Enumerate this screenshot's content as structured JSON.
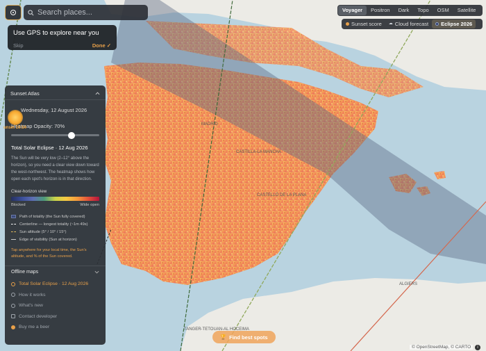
{
  "search": {
    "placeholder": "Search places..."
  },
  "gps_tip": {
    "title": "Use GPS to explore near you",
    "skip": "Skip",
    "done": "Done ✓"
  },
  "basemaps": {
    "items": [
      "Voyager",
      "Positron",
      "Dark",
      "Topo",
      "OSM",
      "Satellite"
    ],
    "active": "Voyager"
  },
  "layers": {
    "items": [
      {
        "label": "Sunset score",
        "icon": "sunset-dot-icon",
        "color": "#e8a04a"
      },
      {
        "label": "Cloud forecast",
        "icon": "cloud-icon",
        "color": "#cfd4da"
      },
      {
        "label": "Eclipse 2026",
        "icon": "eclipse-icon",
        "color": "#2d3a6a"
      }
    ],
    "active": "Eclipse 2026"
  },
  "panel": {
    "title": "Sunset Atlas",
    "date": "Wednesday, 12 August 2026",
    "opacity_label": "Heatmap Opacity: 70%",
    "opacity_value": 0.7,
    "eclipse_title": "Total Solar Eclipse · 12 Aug 2026",
    "description": "The Sun will be very low (2–12° above the horizon), so you need a clear view down toward the west-northwest. The heatmap shows how open each spot's horizon is in that direction.",
    "clear_horizon_label": "Clear-horizon view",
    "blocked": "Blocked",
    "wide_open": "Wide open",
    "legend": [
      {
        "label": "Path of totality (the Sun fully covered)",
        "color": "#3b4a7a"
      },
      {
        "label": "Centerline — longest totality (~1m 49s)",
        "color": "#ffffff"
      },
      {
        "label": "Sun altitude (5° / 10° / 15°)",
        "color": "#e8c060"
      },
      {
        "label": "Edge of visibility (Sun at horizon)",
        "color": "#c9c9c9"
      }
    ],
    "tap_hint": "Tap anywhere for your local time, the Sun's altitude, and % of the Sun covered.",
    "offline_maps": "Offline maps",
    "menu": [
      {
        "label": "Total Solar Eclipse · 12 Aug 2026",
        "icon": "eclipse-icon",
        "active": true
      },
      {
        "label": "How it works",
        "icon": "info-icon",
        "active": false
      },
      {
        "label": "What's new",
        "icon": "sparkle-icon",
        "active": false
      },
      {
        "label": "Contact developer",
        "icon": "mail-icon",
        "active": false
      },
      {
        "label": "Buy me a beer",
        "icon": "beer-icon",
        "active": false
      }
    ]
  },
  "sun_label": "unset 19:54",
  "find_button": "Find best spots",
  "attribution": "© OpenStreetMap, © CARTO",
  "map_labels": [
    "MADRID",
    "CASTILLA-LA MANCHA",
    "CASTELLÓ DE LA PLANA",
    "ALGIERS",
    "TANGER-TETOUAN-AL HOCEIMA"
  ],
  "colors": {
    "accent": "#e8a04a",
    "panel": "#2c3036",
    "sea": "#b9d3e0",
    "totality_band": "#5a6a82"
  }
}
